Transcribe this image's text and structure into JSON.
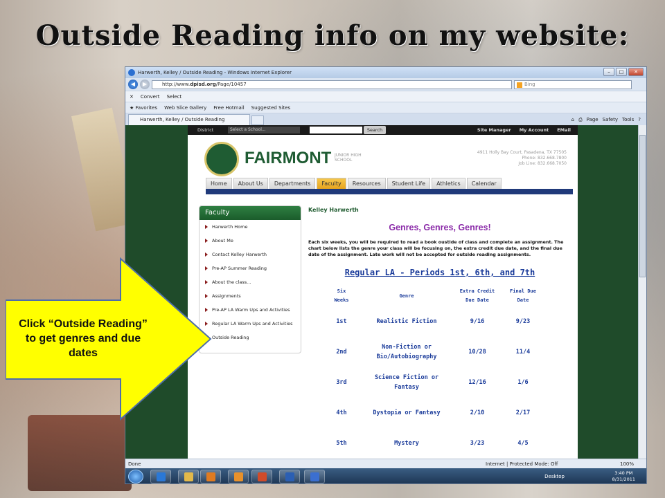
{
  "slide": {
    "title": "Outside Reading info on my website:",
    "callout": "Click “Outside Reading” to get genres and due dates",
    "callout_color": "#ffff00"
  },
  "browser": {
    "window_title": "Harwerth, Kelley / Outside Reading - Windows Internet Explorer",
    "url_prefix": "http://www.",
    "url_domain": "dpisd.org",
    "url_path": "/Page/10457",
    "search_placeholder": "Bing",
    "command_bar": [
      "Convert",
      "Select"
    ],
    "favorites_bar": [
      "Favorites",
      "Web Slice Gallery",
      "Free Hotmail",
      "Suggested Sites"
    ],
    "tab_title": "Harwerth, Kelley / Outside Reading",
    "tools_menu": [
      "Page",
      "Safety",
      "Tools"
    ],
    "status_left": "Done",
    "status_mid": "Internet | Protected Mode: Off",
    "zoom": "100%"
  },
  "site": {
    "topbar": {
      "district": "District",
      "select_school": "Select a School...",
      "search_button": "Search",
      "site_manager": "Site Manager",
      "my_account": "My Account",
      "email": "EMail"
    },
    "school_name": "FAIRMONT",
    "school_sub": "JUNIOR HIGH SCHOOL",
    "address_lines": [
      "4911 Holly Bay Court, Pasadena, TX 77505",
      "Phone: 832.668.7800",
      "Job Line: 832.668.7050"
    ],
    "nav": [
      "Home",
      "About Us",
      "Departments",
      "Faculty",
      "Resources",
      "Student Life",
      "Athletics",
      "Calendar"
    ],
    "nav_active": "Faculty",
    "sidebar": {
      "heading": "Faculty",
      "items": [
        "Harwerth Home",
        "About Me",
        "Contact Kelley Harwerth",
        "Pre-AP Summer Reading",
        "About the class...",
        "Assignments",
        "Pre-AP LA Warm Ups and Activities",
        "Regular LA Warm Ups and Activities",
        "Outside Reading"
      ]
    },
    "teacher_name": "Kelley Harwerth",
    "genres_title": "Genres, Genres, Genres!",
    "intro": "Each six weeks, you will be required to read a book oustide of class and complete an assignment. The chart below lists the genre your class will be focusing on, the extra credit due date, and the final due date of the assignment. Late work will not be accepted for outside reading assignments.",
    "table_title": "Regular LA - Periods 1st, 6th, and 7th",
    "table": {
      "headers": [
        [
          "Six",
          "Weeks"
        ],
        [
          "Genre"
        ],
        [
          "Extra Credit",
          "Due Date"
        ],
        [
          "Final Due",
          "Date"
        ]
      ],
      "rows": [
        {
          "weeks": "1st",
          "genre": [
            "Realistic Fiction"
          ],
          "extra": "9/16",
          "final": "9/23"
        },
        {
          "weeks": "2nd",
          "genre": [
            "Non-Fiction or",
            "Bio/Autobiography"
          ],
          "extra": "10/28",
          "final": "11/4"
        },
        {
          "weeks": "3rd",
          "genre": [
            "Science Fiction or",
            "Fantasy"
          ],
          "extra": "12/16",
          "final": "1/6"
        },
        {
          "weeks": "4th",
          "genre": [
            "Dystopia or Fantasy"
          ],
          "extra": "2/10",
          "final": "2/17"
        },
        {
          "weeks": "5th",
          "genre": [
            "Mystery"
          ],
          "extra": "3/23",
          "final": "4/5"
        }
      ]
    }
  },
  "taskbar": {
    "desktop_label": "Desktop",
    "time": "3:40 PM",
    "date": "8/31/2011"
  }
}
